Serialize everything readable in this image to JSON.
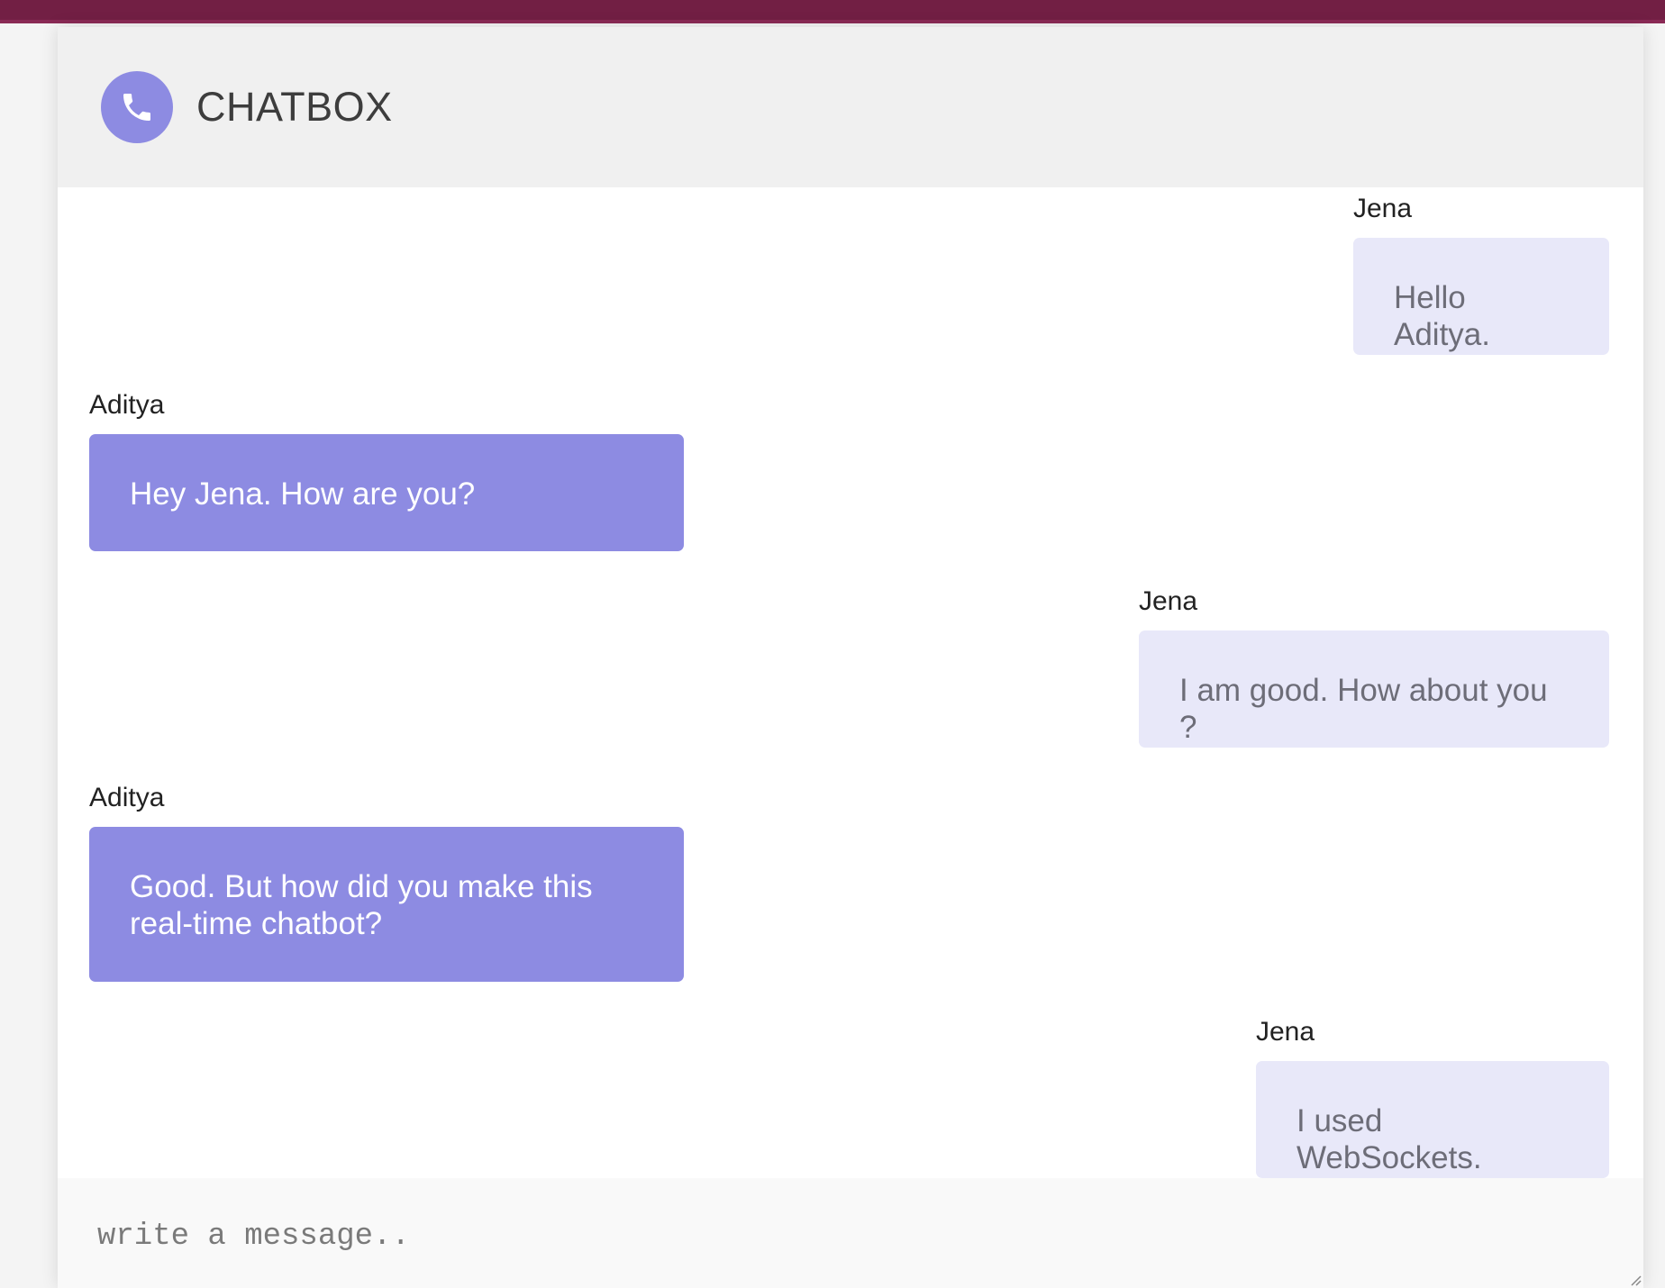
{
  "header": {
    "title": "CHATBOX",
    "icon": "phone-icon"
  },
  "messages": [
    {
      "sender": "Jena",
      "text": "Hello Aditya.",
      "side": "right"
    },
    {
      "sender": "Aditya",
      "text": "Hey Jena. How are you?",
      "side": "left"
    },
    {
      "sender": "Jena",
      "text": "I am good. How about you ?",
      "side": "right"
    },
    {
      "sender": "Aditya",
      "text": "Good. But how did you make this real-time chatbot?",
      "side": "left"
    },
    {
      "sender": "Jena",
      "text": "I used WebSockets.",
      "side": "right"
    }
  ],
  "composer": {
    "placeholder": "write a message..",
    "value": ""
  },
  "colors": {
    "top_bar": "#721f44",
    "accent": "#8d8be2",
    "incoming_bubble": "#e8e8f9",
    "header_bg": "#f0f0f0"
  }
}
